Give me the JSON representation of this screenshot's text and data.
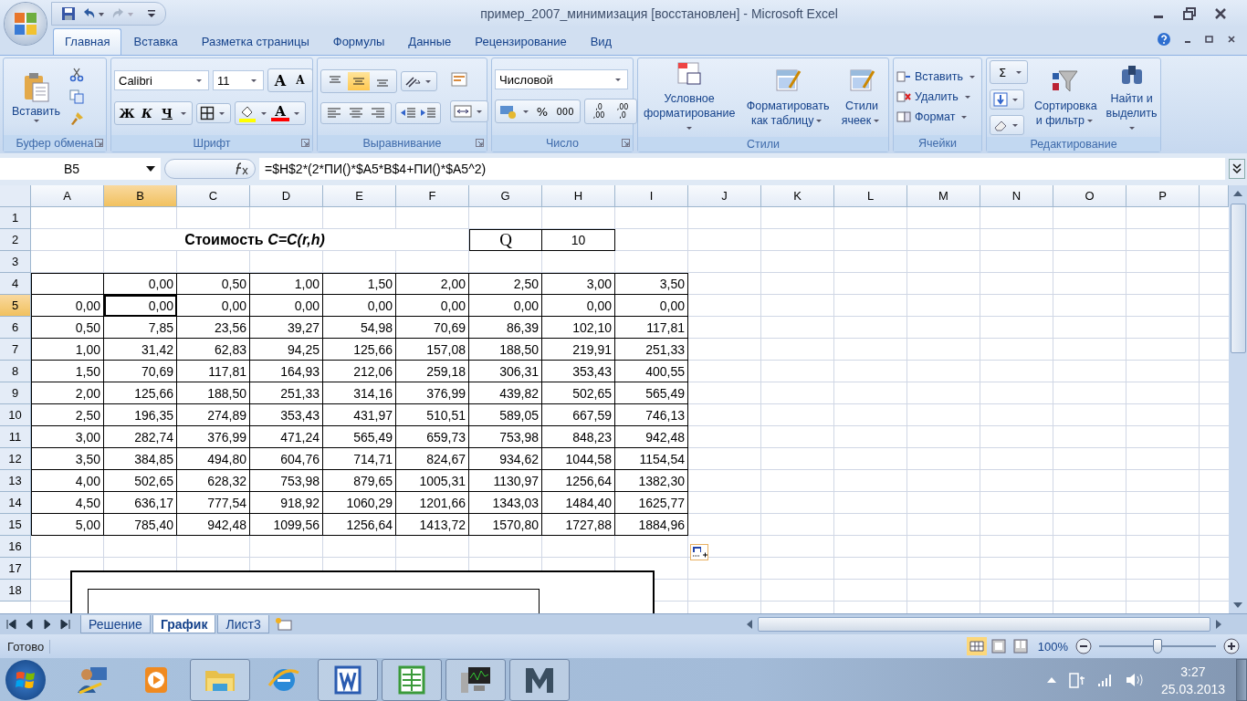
{
  "window": {
    "title": "пример_2007_минимизация [восстановлен] - Microsoft Excel"
  },
  "tabs": [
    {
      "label": "Главная",
      "selected": true
    },
    {
      "label": "Вставка",
      "selected": false
    },
    {
      "label": "Разметка страницы",
      "selected": false
    },
    {
      "label": "Формулы",
      "selected": false
    },
    {
      "label": "Данные",
      "selected": false
    },
    {
      "label": "Рецензирование",
      "selected": false
    },
    {
      "label": "Вид",
      "selected": false
    }
  ],
  "ribbon": {
    "groups": [
      {
        "label": "Буфер обмена",
        "launcher": true,
        "paste": "Вставить"
      },
      {
        "label": "Шрифт",
        "launcher": true,
        "font": "Calibri",
        "size": "11",
        "grow": "A",
        "shrink": "A",
        "bold": "Ж",
        "italic": "К",
        "underline": "Ч",
        "font_color": "A"
      },
      {
        "label": "Выравнивание",
        "launcher": true,
        "vertical_align": [
          {
            "selected": false
          },
          {
            "selected": true
          },
          {
            "selected": false
          }
        ]
      },
      {
        "label": "Число",
        "launcher": true,
        "format": "Числовой",
        "percent": "%",
        "thousands": "000",
        "decimals": [
          {
            "top": ",0",
            "bottom": ",00"
          },
          {
            "top": ",00",
            "bottom": ",0"
          }
        ]
      },
      {
        "label": "Стили",
        "launcher": false,
        "buttons": [
          "Условное форматирование",
          "Форматировать как таблицу",
          "Стили ячеек"
        ]
      },
      {
        "label": "Ячейки",
        "launcher": false,
        "buttons": [
          "Вставить",
          "Удалить",
          "Формат"
        ]
      },
      {
        "label": "Редактирование",
        "launcher": false,
        "sum": "Σ",
        "buttons": [
          "Сортировка и фильтр",
          "Найти и выделить"
        ]
      }
    ]
  },
  "formula_bar": {
    "name_box": "B5",
    "formula": "=$H$2*(2*ПИ()*$A5*B$4+ПИ()*$A5^2)"
  },
  "sheet": {
    "columns": [
      {
        "label": "A",
        "selected": false
      },
      {
        "label": "B",
        "selected": true
      },
      {
        "label": "C",
        "selected": false
      },
      {
        "label": "D",
        "selected": false
      },
      {
        "label": "E",
        "selected": false
      },
      {
        "label": "F",
        "selected": false
      },
      {
        "label": "G",
        "selected": false
      },
      {
        "label": "H",
        "selected": false
      },
      {
        "label": "I",
        "selected": false
      },
      {
        "label": "J",
        "selected": false
      },
      {
        "label": "K",
        "selected": false
      },
      {
        "label": "L",
        "selected": false
      },
      {
        "label": "M",
        "selected": false
      },
      {
        "label": "N",
        "selected": false
      },
      {
        "label": "O",
        "selected": false
      },
      {
        "label": "P",
        "selected": false
      }
    ],
    "rows": [
      {
        "number": "1",
        "selected": false,
        "kind": "blank"
      },
      {
        "number": "2",
        "selected": false,
        "kind": "heading",
        "title": "Стоимость *C=C(r,h)*",
        "q_label": "Q",
        "q_value": "10"
      },
      {
        "number": "3",
        "selected": false,
        "kind": "blank"
      },
      {
        "number": "4",
        "selected": false,
        "kind": "table",
        "cells": [
          null,
          "0,00",
          "0,50",
          "1,00",
          "1,50",
          "2,00",
          "2,50",
          "3,00",
          "3,50"
        ]
      },
      {
        "number": "5",
        "selected": true,
        "kind": "table",
        "cells": [
          "0,00",
          "0,00",
          "0,00",
          "0,00",
          "0,00",
          "0,00",
          "0,00",
          "0,00",
          "0,00"
        ]
      },
      {
        "number": "6",
        "selected": false,
        "kind": "table",
        "cells": [
          "0,50",
          "7,85",
          "23,56",
          "39,27",
          "54,98",
          "70,69",
          "86,39",
          "102,10",
          "117,81"
        ]
      },
      {
        "number": "7",
        "selected": false,
        "kind": "table",
        "cells": [
          "1,00",
          "31,42",
          "62,83",
          "94,25",
          "125,66",
          "157,08",
          "188,50",
          "219,91",
          "251,33"
        ]
      },
      {
        "number": "8",
        "selected": false,
        "kind": "table",
        "cells": [
          "1,50",
          "70,69",
          "117,81",
          "164,93",
          "212,06",
          "259,18",
          "306,31",
          "353,43",
          "400,55"
        ]
      },
      {
        "number": "9",
        "selected": false,
        "kind": "table",
        "cells": [
          "2,00",
          "125,66",
          "188,50",
          "251,33",
          "314,16",
          "376,99",
          "439,82",
          "502,65",
          "565,49"
        ]
      },
      {
        "number": "10",
        "selected": false,
        "kind": "table",
        "cells": [
          "2,50",
          "196,35",
          "274,89",
          "353,43",
          "431,97",
          "510,51",
          "589,05",
          "667,59",
          "746,13"
        ]
      },
      {
        "number": "11",
        "selected": false,
        "kind": "table",
        "cells": [
          "3,00",
          "282,74",
          "376,99",
          "471,24",
          "565,49",
          "659,73",
          "753,98",
          "848,23",
          "942,48"
        ]
      },
      {
        "number": "12",
        "selected": false,
        "kind": "table",
        "cells": [
          "3,50",
          "384,85",
          "494,80",
          "604,76",
          "714,71",
          "824,67",
          "934,62",
          "1044,58",
          "1154,54"
        ]
      },
      {
        "number": "13",
        "selected": false,
        "kind": "table",
        "cells": [
          "4,00",
          "502,65",
          "628,32",
          "753,98",
          "879,65",
          "1005,31",
          "1130,97",
          "1256,64",
          "1382,30"
        ]
      },
      {
        "number": "14",
        "selected": false,
        "kind": "table",
        "cells": [
          "4,50",
          "636,17",
          "777,54",
          "918,92",
          "1060,29",
          "1201,66",
          "1343,03",
          "1484,40",
          "1625,77"
        ]
      },
      {
        "number": "15",
        "selected": false,
        "kind": "table",
        "cells": [
          "5,00",
          "785,40",
          "942,48",
          "1099,56",
          "1256,64",
          "1413,72",
          "1570,80",
          "1727,88",
          "1884,96"
        ]
      },
      {
        "number": "16",
        "selected": false,
        "kind": "blank"
      },
      {
        "number": "17",
        "selected": false,
        "kind": "blank"
      },
      {
        "number": "18",
        "selected": false,
        "kind": "blank"
      }
    ]
  },
  "sheet_tabs": [
    {
      "label": "Решение",
      "selected": false
    },
    {
      "label": "График",
      "selected": true
    },
    {
      "label": "Лист3",
      "selected": false
    }
  ],
  "status_bar": {
    "text": "Готово",
    "zoom": {
      "reading": "100%",
      "level": 0.5
    }
  },
  "taskbar": {
    "apps": [
      {
        "kind": "remote",
        "running": false
      },
      {
        "kind": "media",
        "running": false
      },
      {
        "kind": "folder",
        "running": true
      },
      {
        "kind": "browser",
        "running": false
      },
      {
        "kind": "word",
        "running": true
      },
      {
        "kind": "excel",
        "running": true
      },
      {
        "kind": "monitor",
        "running": true
      },
      {
        "kind": "m",
        "running": true
      }
    ],
    "time": "3:27",
    "date": "25.03.2013"
  }
}
